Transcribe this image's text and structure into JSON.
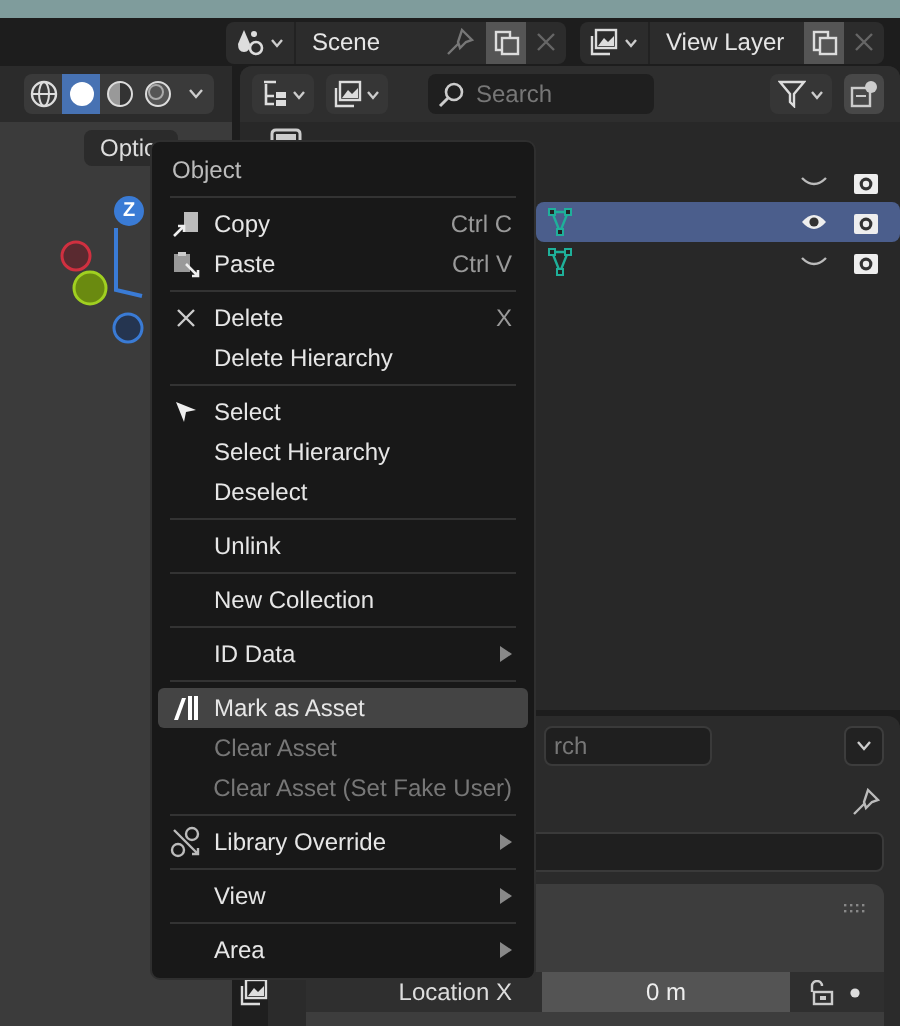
{
  "topbar": {
    "scene": "Scene",
    "view_layer": "View Layer"
  },
  "viewport": {
    "options_button": "Optio",
    "gizmo_axis": "Z",
    "shading_modes": [
      {
        "selected": false
      },
      {
        "selected": true
      },
      {
        "selected": false
      },
      {
        "selected": false
      }
    ]
  },
  "outliner": {
    "search_placeholder": "Search",
    "rows": [
      {
        "selected": false,
        "visible": false
      },
      {
        "selected": true,
        "visible": true
      },
      {
        "selected": false,
        "visible": false
      }
    ]
  },
  "properties": {
    "search_placeholder": "rch",
    "location_label": "Location X",
    "location_value": "0 m"
  },
  "context_menu": {
    "title": "Object",
    "items": [
      {
        "kind": "item",
        "label": "Copy",
        "shortcut": "Ctrl C",
        "disabled": false,
        "selected": false,
        "submenu": false
      },
      {
        "kind": "item",
        "label": "Paste",
        "shortcut": "Ctrl V",
        "disabled": false,
        "selected": false,
        "submenu": false
      },
      {
        "kind": "separator"
      },
      {
        "kind": "item",
        "label": "Delete",
        "shortcut": "X",
        "disabled": false,
        "selected": false,
        "submenu": false
      },
      {
        "kind": "item",
        "label": "Delete Hierarchy",
        "disabled": false,
        "selected": false,
        "submenu": false
      },
      {
        "kind": "separator"
      },
      {
        "kind": "item",
        "label": "Select",
        "disabled": false,
        "selected": false,
        "submenu": false
      },
      {
        "kind": "item",
        "label": "Select Hierarchy",
        "disabled": false,
        "selected": false,
        "submenu": false
      },
      {
        "kind": "item",
        "label": "Deselect",
        "disabled": false,
        "selected": false,
        "submenu": false
      },
      {
        "kind": "separator"
      },
      {
        "kind": "item",
        "label": "Unlink",
        "disabled": false,
        "selected": false,
        "submenu": false
      },
      {
        "kind": "separator"
      },
      {
        "kind": "item",
        "label": "New Collection",
        "disabled": false,
        "selected": false,
        "submenu": false
      },
      {
        "kind": "separator"
      },
      {
        "kind": "item",
        "label": "ID Data",
        "disabled": false,
        "selected": false,
        "submenu": true
      },
      {
        "kind": "separator"
      },
      {
        "kind": "item",
        "label": "Mark as Asset",
        "disabled": false,
        "selected": true,
        "submenu": false
      },
      {
        "kind": "item",
        "label": "Clear Asset",
        "disabled": true,
        "selected": false,
        "submenu": false
      },
      {
        "kind": "item",
        "label": "Clear Asset (Set Fake User)",
        "disabled": true,
        "selected": false,
        "submenu": false
      },
      {
        "kind": "separator"
      },
      {
        "kind": "item",
        "label": "Library Override",
        "disabled": false,
        "selected": false,
        "submenu": true
      },
      {
        "kind": "separator"
      },
      {
        "kind": "item",
        "label": "View",
        "disabled": false,
        "selected": false,
        "submenu": true
      },
      {
        "kind": "separator"
      },
      {
        "kind": "item",
        "label": "Area",
        "disabled": false,
        "selected": false,
        "submenu": true
      }
    ]
  }
}
